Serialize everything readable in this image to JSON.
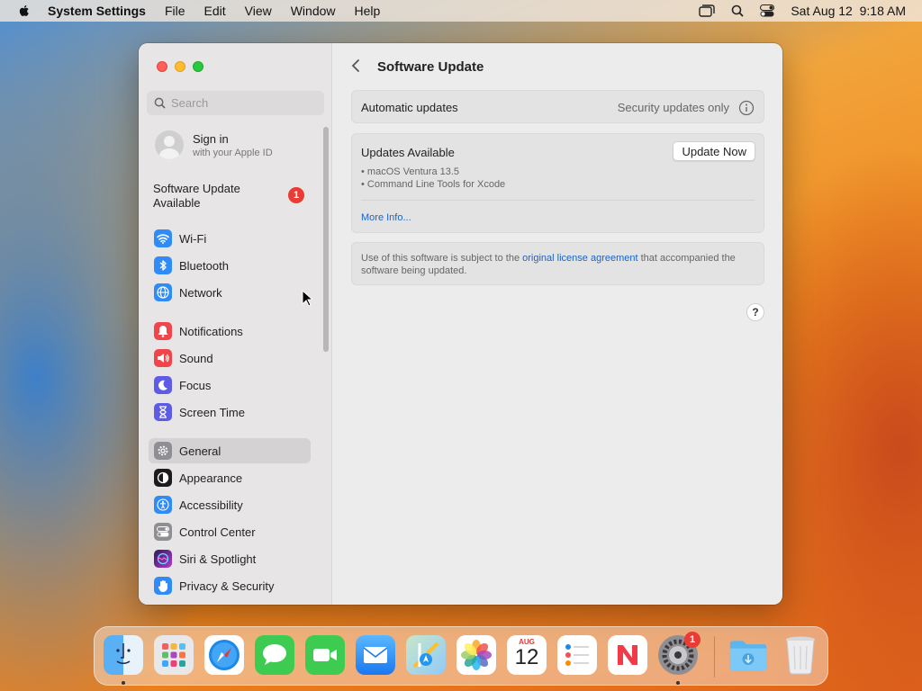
{
  "menubar": {
    "app_name": "System Settings",
    "menus": [
      "File",
      "Edit",
      "View",
      "Window",
      "Help"
    ],
    "clock": "Sat Aug 12  9:18 AM"
  },
  "sidebar": {
    "search_placeholder": "Search",
    "account": {
      "title": "Sign in",
      "subtitle": "with your Apple ID"
    },
    "software_update": {
      "label_line1": "Software Update",
      "label_line2": "Available",
      "badge": "1"
    },
    "items": [
      {
        "label": "Wi-Fi",
        "icon": "wifi-icon",
        "color": "#2f8cf6"
      },
      {
        "label": "Bluetooth",
        "icon": "bluetooth-icon",
        "color": "#2f8cf6"
      },
      {
        "label": "Network",
        "icon": "globe-icon",
        "color": "#2f8cf6"
      },
      {
        "label": "Notifications",
        "icon": "bell-icon",
        "color": "#f0454a"
      },
      {
        "label": "Sound",
        "icon": "speaker-icon",
        "color": "#f0454a"
      },
      {
        "label": "Focus",
        "icon": "moon-icon",
        "color": "#5e5ce6"
      },
      {
        "label": "Screen Time",
        "icon": "hourglass-icon",
        "color": "#5e5ce6"
      },
      {
        "label": "General",
        "icon": "gear-icon",
        "color": "#8e8e93",
        "selected": true
      },
      {
        "label": "Appearance",
        "icon": "appearance-icon",
        "color": "#1c1c1e"
      },
      {
        "label": "Accessibility",
        "icon": "accessibility-icon",
        "color": "#2f8cf6"
      },
      {
        "label": "Control Center",
        "icon": "control-center-icon",
        "color": "#8e8e93"
      },
      {
        "label": "Siri & Spotlight",
        "icon": "siri-icon",
        "color": "#7a3bd1"
      },
      {
        "label": "Privacy & Security",
        "icon": "hand-icon",
        "color": "#2f8cf6"
      }
    ]
  },
  "main": {
    "title": "Software Update",
    "automatic": {
      "label": "Automatic updates",
      "value": "Security updates only"
    },
    "updates": {
      "label": "Updates Available",
      "button": "Update Now",
      "list": [
        "• macOS Ventura 13.5",
        "• Command Line Tools for Xcode"
      ],
      "more_info": "More Info..."
    },
    "license": {
      "text_before": "Use of this software is subject to the ",
      "link": "original license agreement",
      "text_after": " that accompanied the software being updated."
    },
    "help": "?"
  },
  "dock": {
    "apps": [
      "finder-icon",
      "launchpad-icon",
      "safari-icon",
      "messages-icon",
      "facetime-icon",
      "mail-icon",
      "maps-icon",
      "photos-icon",
      "calendar-icon",
      "reminders-icon",
      "news-icon",
      "system-settings-icon",
      "downloads-folder-icon",
      "trash-icon"
    ],
    "calendar": {
      "month": "AUG",
      "day": "12"
    },
    "settings_badge": "1"
  }
}
